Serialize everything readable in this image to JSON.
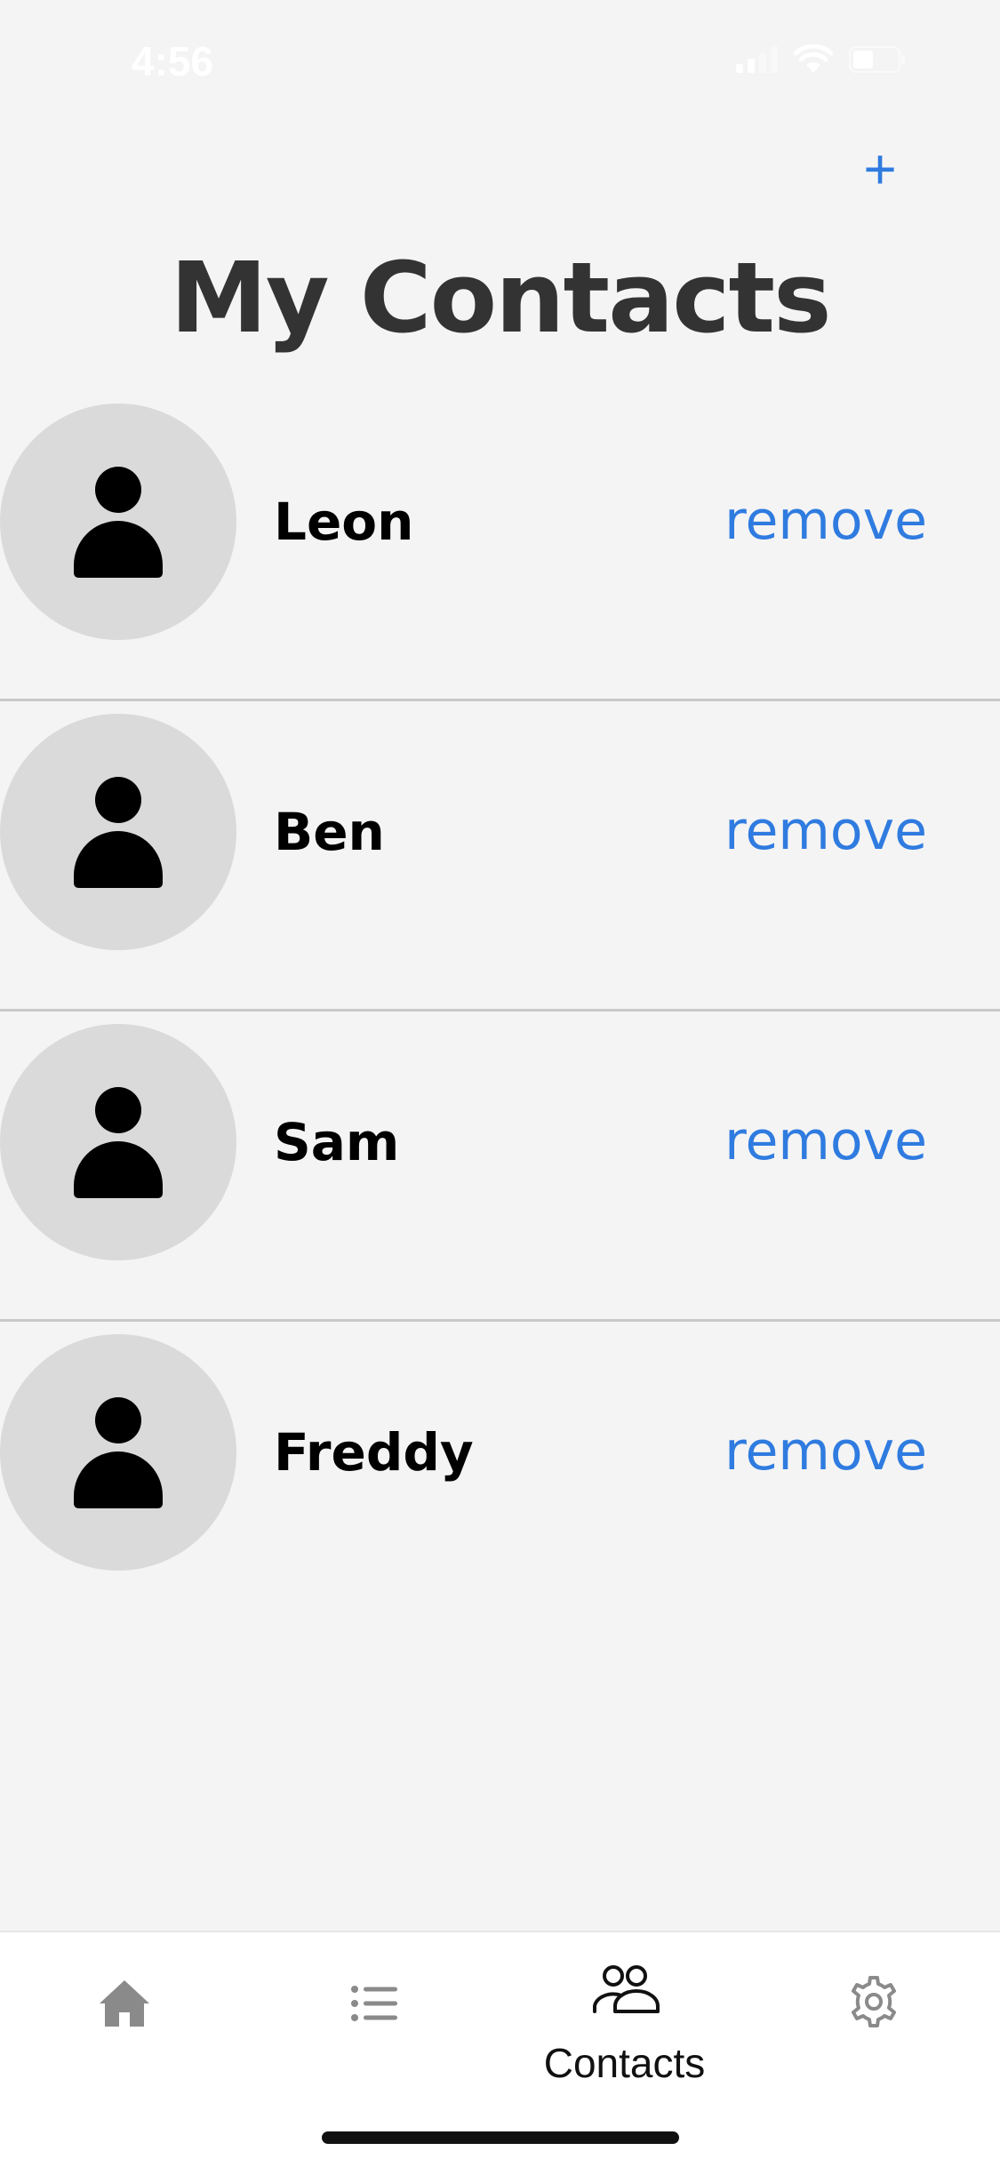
{
  "status_bar": {
    "time": "4:56"
  },
  "header": {
    "add_label": "+",
    "title": "My Contacts"
  },
  "contacts": [
    {
      "name": "Leon",
      "action": "remove"
    },
    {
      "name": "Ben",
      "action": "remove"
    },
    {
      "name": "Sam",
      "action": "remove"
    },
    {
      "name": "Freddy",
      "action": "remove"
    }
  ],
  "tab_bar": {
    "tabs": [
      {
        "icon": "home-icon",
        "label": ""
      },
      {
        "icon": "list-icon",
        "label": ""
      },
      {
        "icon": "contacts-icon",
        "label": "Contacts",
        "active": true
      },
      {
        "icon": "gear-icon",
        "label": ""
      }
    ]
  },
  "colors": {
    "accent": "#2f7be0",
    "background": "#f4f4f4",
    "avatar": "#dadada",
    "title": "#333333"
  }
}
